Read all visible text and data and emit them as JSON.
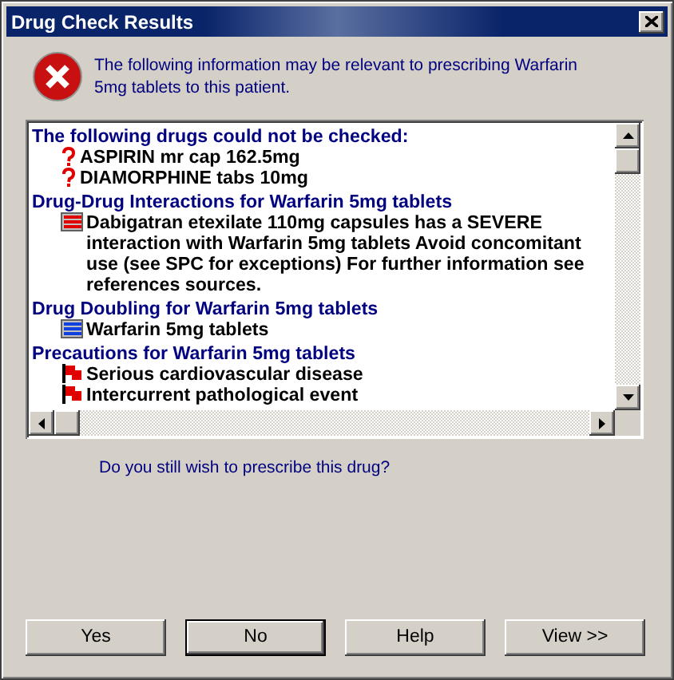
{
  "window": {
    "title": "Drug Check Results"
  },
  "message": "The following information may be relevant to prescribing Warfarin 5mg tablets to this patient.",
  "sections": [
    {
      "heading": "The following drugs could not be checked:",
      "items": [
        {
          "kind": "unchecked",
          "text": "ASPIRIN mr cap 162.5mg"
        },
        {
          "kind": "unchecked",
          "text": "DIAMORPHINE tabs 10mg"
        }
      ]
    },
    {
      "heading": "Drug-Drug Interactions for Warfarin 5mg tablets",
      "items": [
        {
          "kind": "interaction",
          "text": "Dabigatran etexilate 110mg capsules has a SEVERE interaction with Warfarin 5mg tablets Avoid concomitant use (see SPC for exceptions) For further information see references sources."
        }
      ]
    },
    {
      "heading": "Drug Doubling for Warfarin 5mg tablets",
      "items": [
        {
          "kind": "doubling",
          "text": "Warfarin 5mg tablets"
        }
      ]
    },
    {
      "heading": "Precautions for Warfarin 5mg tablets",
      "items": [
        {
          "kind": "precaution",
          "text": "Serious cardiovascular disease"
        },
        {
          "kind": "precaution",
          "text": "Intercurrent pathological event"
        }
      ]
    }
  ],
  "question": "Do you still wish to prescribe this drug?",
  "buttons": [
    {
      "label": "Yes",
      "default": false
    },
    {
      "label": "No",
      "default": true
    },
    {
      "label": "Help",
      "default": false
    },
    {
      "label": "View >>",
      "default": false
    }
  ]
}
